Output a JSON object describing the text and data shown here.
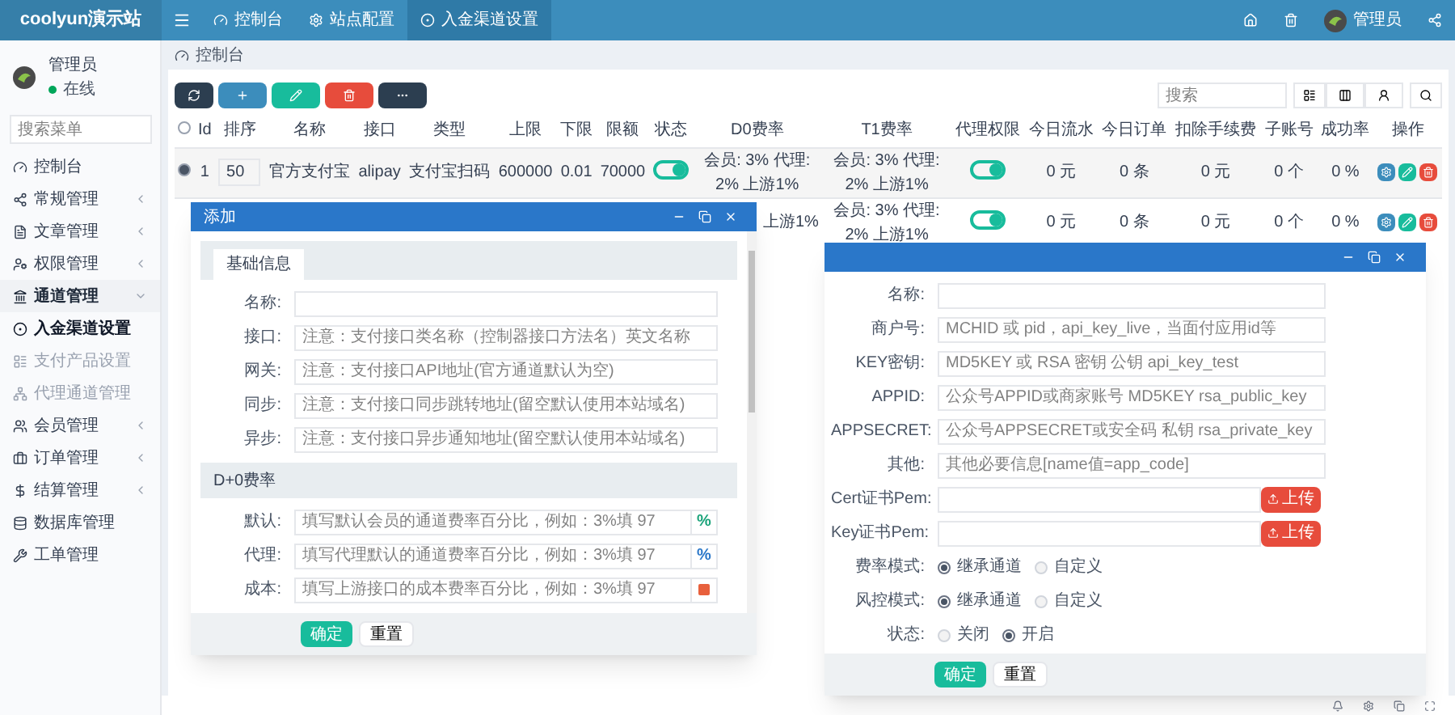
{
  "header": {
    "logo": "coolyun演示站",
    "tabs": [
      {
        "label": "控制台",
        "selected": false
      },
      {
        "label": "站点配置",
        "selected": false
      },
      {
        "label": "入金渠道设置",
        "selected": true
      }
    ],
    "user": "管理员"
  },
  "sidebar": {
    "user": {
      "name": "管理员",
      "status": "在线"
    },
    "search": {
      "placeholder": "搜索菜单"
    },
    "items": [
      {
        "label": "控制台"
      },
      {
        "label": "常规管理",
        "expanded": false
      },
      {
        "label": "文章管理",
        "expanded": false
      },
      {
        "label": "权限管理",
        "expanded": false
      },
      {
        "label": "通道管理",
        "expanded": true,
        "children": [
          {
            "label": "入金渠道设置",
            "selected": true
          },
          {
            "label": "支付产品设置",
            "selected": false
          },
          {
            "label": "代理通道管理",
            "selected": false
          }
        ]
      },
      {
        "label": "会员管理",
        "expanded": false
      },
      {
        "label": "订单管理",
        "expanded": false
      },
      {
        "label": "结算管理",
        "expanded": false
      },
      {
        "label": "数据库管理"
      },
      {
        "label": "工单管理"
      }
    ]
  },
  "breadcrumb": "控制台",
  "toolbar": {
    "search": {
      "placeholder": "搜索"
    }
  },
  "table": {
    "select_all": {
      "checked": false
    },
    "columns": [
      "Id",
      "排序",
      "名称",
      "接口",
      "类型",
      "上限",
      "下限",
      "限额",
      "状态",
      "D0费率",
      "T1费率",
      "代理权限",
      "今日流水",
      "今日订单",
      "扣除手续费",
      "子账号",
      "成功率",
      "操作"
    ],
    "rows": [
      {
        "checked": true,
        "id": "1",
        "sort": "50",
        "name": "官方支付宝",
        "api": "alipay",
        "type": "支付宝扫码",
        "max": "600000",
        "min": "0.01",
        "limit": "70000",
        "status_on": true,
        "d0": "会员: 3% 代理: 2% 上游1%",
        "t1": "会员: 3% 代理: 2% 上游1%",
        "agent_on": true,
        "flow": "0 元",
        "orders": "0 条",
        "fee": "0 元",
        "sub": "0 个",
        "rate": "0 %",
        "actions": true
      },
      {
        "d0": "上游1%",
        "t1": "会员: 3% 代理: 2% 上游1%",
        "agent_on": true,
        "flow": "0 元",
        "orders": "0 条",
        "fee": "0 元",
        "sub": "0 个",
        "rate": "0 %",
        "actions": true
      }
    ]
  },
  "add_dialog": {
    "title": "添加",
    "tabs": [
      {
        "label": "基础信息",
        "selected": true
      }
    ],
    "fields": [
      {
        "label": "名称:"
      },
      {
        "label": "接口:",
        "placeholder": "注意：支付接口类名称（控制器接口方法名）英文名称"
      },
      {
        "label": "网关:",
        "placeholder": "注意：支付接口API地址(官方通道默认为空)"
      },
      {
        "label": "同步:",
        "placeholder": "注意：支付接口同步跳转地址(留空默认使用本站域名)"
      },
      {
        "label": "异步:",
        "placeholder": "注意：支付接口异步通知地址(留空默认使用本站域名)"
      }
    ],
    "section": "D+0费率",
    "rate_fields": [
      {
        "label": "默认:",
        "placeholder": "填写默认会员的通道费率百分比，例如：3%填 97",
        "addon": {
          "kind": "text",
          "text": "%",
          "color": "#1aa37a"
        }
      },
      {
        "label": "代理:",
        "placeholder": "填写代理默认的通道费率百分比，例如：3%填 97",
        "addon": {
          "kind": "text",
          "text": "%",
          "color": "#2a77c9"
        }
      },
      {
        "label": "成本:",
        "placeholder": "填写上游接口的成本费率百分比，例如：3%填 97",
        "addon": {
          "kind": "icon",
          "color": "#e8603c"
        }
      }
    ],
    "buttons": [
      "确定",
      "重置"
    ]
  },
  "edit_dialog": {
    "fields": [
      {
        "kind": "text",
        "label": "名称:"
      },
      {
        "kind": "text",
        "label": "商户号:",
        "placeholder": "MCHID 或 pid，api_key_live，当面付应用id等"
      },
      {
        "kind": "text",
        "label": "KEY密钥:",
        "placeholder": "MD5KEY 或 RSA 密钥 公钥 api_key_test"
      },
      {
        "kind": "text",
        "label": "APPID:",
        "placeholder": "公众号APPID或商家账号 MD5KEY rsa_public_key"
      },
      {
        "kind": "text",
        "label": "APPSECRET:",
        "placeholder": "公众号APPSECRET或安全码 私钥 rsa_private_key"
      },
      {
        "kind": "text",
        "label": "其他:",
        "placeholder": "其他必要信息[name值=app_code]"
      },
      {
        "kind": "upload",
        "label": "Cert证书Pem:",
        "button": "上传"
      },
      {
        "kind": "upload",
        "label": "Key证书Pem:",
        "button": "上传"
      }
    ],
    "radios": [
      {
        "label": "费率模式:",
        "options": [
          {
            "label": "继承通道",
            "selected": true
          },
          {
            "label": "自定义",
            "selected": false
          }
        ]
      },
      {
        "label": "风控模式:",
        "options": [
          {
            "label": "继承通道",
            "selected": true
          },
          {
            "label": "自定义",
            "selected": false
          }
        ]
      },
      {
        "label": "状态:",
        "options": [
          {
            "label": "关闭",
            "selected": false
          },
          {
            "label": "开启",
            "selected": true
          }
        ]
      }
    ],
    "buttons": [
      "确定",
      "重置"
    ]
  }
}
